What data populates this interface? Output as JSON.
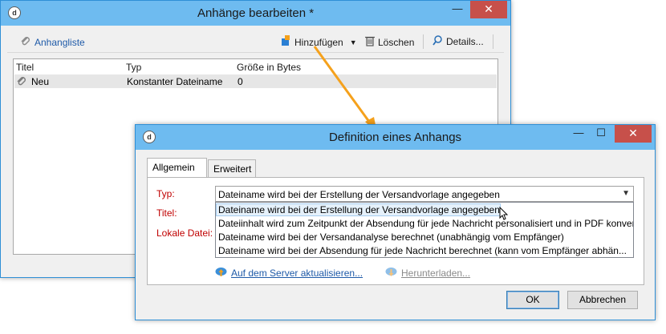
{
  "main_window": {
    "title": "Anhänge bearbeiten *",
    "controls": {
      "minimize": "—",
      "maximize": "☐",
      "close": "✕"
    },
    "toolbar": {
      "list_label": "Anhangliste",
      "add_label": "Hinzufügen",
      "delete_label": "Löschen",
      "details_label": "Details..."
    },
    "table": {
      "headers": [
        "Titel",
        "Typ",
        "Größe in Bytes"
      ],
      "rows": [
        {
          "title": "Neu",
          "type": "Konstanter Dateiname",
          "size": "0"
        }
      ]
    }
  },
  "dialog": {
    "title": "Definition eines Anhangs",
    "controls": {
      "minimize": "—",
      "maximize": "☐",
      "close": "✕"
    },
    "tabs": [
      "Allgemein",
      "Erweitert"
    ],
    "fields": {
      "type_label": "Typ:",
      "title_label": "Titel:",
      "local_file_label": "Lokale Datei:"
    },
    "type_select": {
      "value": "Dateiname wird bei der Erstellung der Versandvorlage angegeben",
      "options": [
        "Dateiname wird bei der Erstellung der Versandvorlage angegeben",
        "Dateiinhalt wird zum Zeitpunkt der Absendung für jede Nachricht personalisiert und in PDF konver",
        "Dateiname wird bei der Versandanalyse berechnet (unabhängig vom Empfänger)",
        "Dateiname wird bei der Absendung für jede Nachricht berechnet (kann vom Empfänger abhän..."
      ]
    },
    "links": {
      "upload_label": "Auf dem Server aktualisieren...",
      "download_label": "Herunterladen..."
    },
    "buttons": {
      "ok_label": "OK",
      "cancel_label": "Abbrechen"
    }
  },
  "colors": {
    "titlebar": "#6ebbf0",
    "close_button": "#c7504a",
    "arrow": "#f5a11c",
    "required_label": "#c00000",
    "link": "#1e5aa8"
  }
}
